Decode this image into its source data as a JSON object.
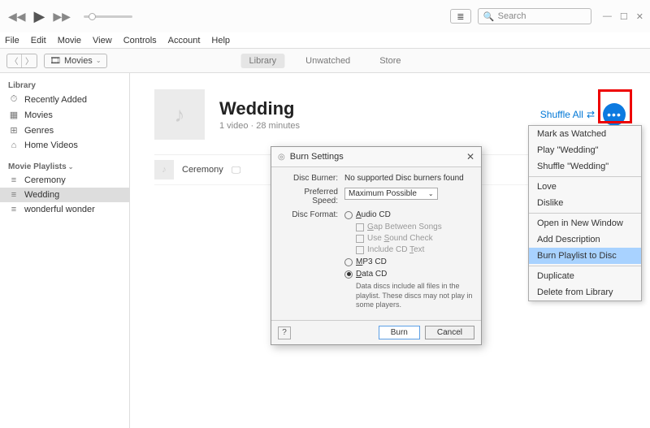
{
  "titlebar": {
    "search_placeholder": "Search"
  },
  "menubar": [
    "File",
    "Edit",
    "Movie",
    "View",
    "Controls",
    "Account",
    "Help"
  ],
  "subtoolbar": {
    "category": "Movies",
    "tabs": {
      "library": "Library",
      "unwatched": "Unwatched",
      "store": "Store"
    }
  },
  "sidebar": {
    "library_head": "Library",
    "library_items": [
      {
        "icon": "⏱",
        "label": "Recently Added"
      },
      {
        "icon": "▦",
        "label": "Movies"
      },
      {
        "icon": "⊞",
        "label": "Genres"
      },
      {
        "icon": "⌂",
        "label": "Home Videos"
      }
    ],
    "playlists_head": "Movie Playlists",
    "playlists": [
      {
        "icon": "≡",
        "label": "Ceremony"
      },
      {
        "icon": "≡",
        "label": "Wedding",
        "selected": true
      },
      {
        "icon": "≡",
        "label": "wonderful wonder"
      }
    ]
  },
  "content": {
    "title": "Wedding",
    "subtitle": "1 video · 28 minutes",
    "shuffle": "Shuffle All",
    "track0": "Ceremony"
  },
  "context_menu": {
    "items": [
      "Mark as Watched",
      "Play \"Wedding\"",
      "Shuffle \"Wedding\"",
      "---",
      "Love",
      "Dislike",
      "---",
      "Open in New Window",
      "Add Description",
      "Burn Playlist to Disc",
      "---",
      "Duplicate",
      "Delete from Library"
    ],
    "highlighted": "Burn Playlist to Disc"
  },
  "dialog": {
    "title": "Burn Settings",
    "disc_burner_label": "Disc Burner:",
    "disc_burner_value": "No supported Disc burners found",
    "speed_label": "Preferred Speed:",
    "speed_value": "Maximum Possible",
    "format_label": "Disc Format:",
    "radio_audio": "Audio CD",
    "chk_gap": "Gap Between Songs",
    "chk_soundcheck": "Use Sound Check",
    "chk_cdtext": "Include CD Text",
    "radio_mp3": "MP3 CD",
    "radio_data": "Data CD",
    "data_hint": "Data discs include all files in the playlist. These discs may not play in some players.",
    "help": "?",
    "burn": "Burn",
    "cancel": "Cancel"
  }
}
